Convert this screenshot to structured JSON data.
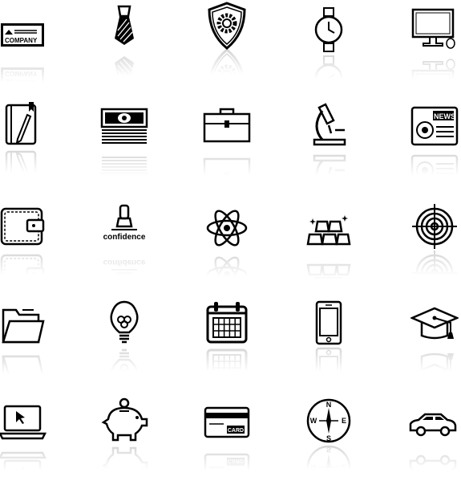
{
  "icons": {
    "company_card": "COMPANY",
    "news": "NEWS",
    "confidence": "confidence",
    "card": "CARD",
    "compass": {
      "n": "N",
      "s": "S",
      "w": "W",
      "e": "E"
    }
  },
  "colors": {
    "icon": "#000000",
    "background": "#ffffff"
  }
}
